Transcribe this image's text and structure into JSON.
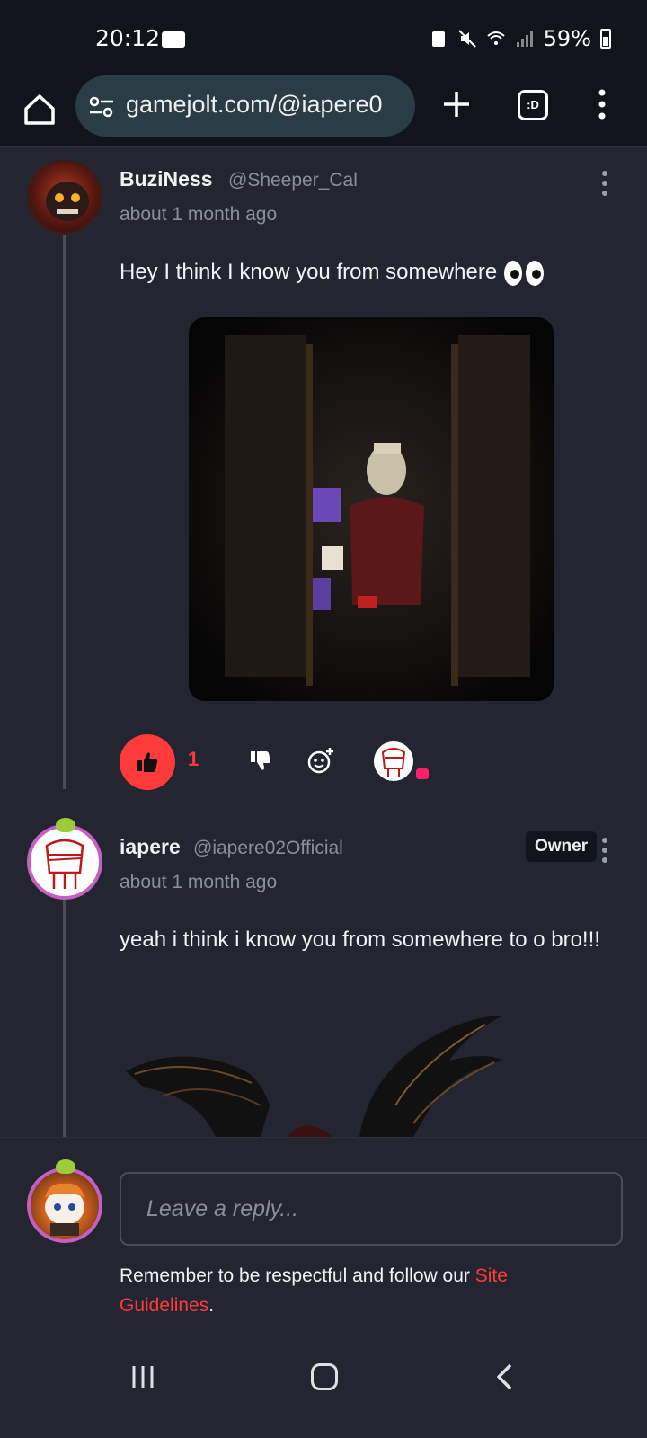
{
  "status_bar": {
    "time": "20:12",
    "battery": "59%"
  },
  "browser": {
    "url": "gamejolt.com/@iapere0",
    "tabs_label": ":D"
  },
  "comments": [
    {
      "username": "BuziNess",
      "handle": "@Sheeper_Cal",
      "time": "about 1 month ago",
      "text": "Hey I think I know you from somewhere",
      "likes": "1"
    },
    {
      "username": "iapere",
      "handle": "@iapere02Official",
      "badge": "Owner",
      "time": "about 1 month ago",
      "text": "yeah i think i know you from somewhere to o bro!!!"
    }
  ],
  "composer": {
    "placeholder": "Leave a reply...",
    "guideline_prefix": "Remember to be respectful and follow our ",
    "guideline_link_1": "Site",
    "guideline_link_2": "Guidelines",
    "guideline_suffix": "."
  },
  "colors": {
    "accent": "#ff3a3a",
    "background": "#232530",
    "bar": "#11141b",
    "owner_ring": "#c55fc4"
  }
}
